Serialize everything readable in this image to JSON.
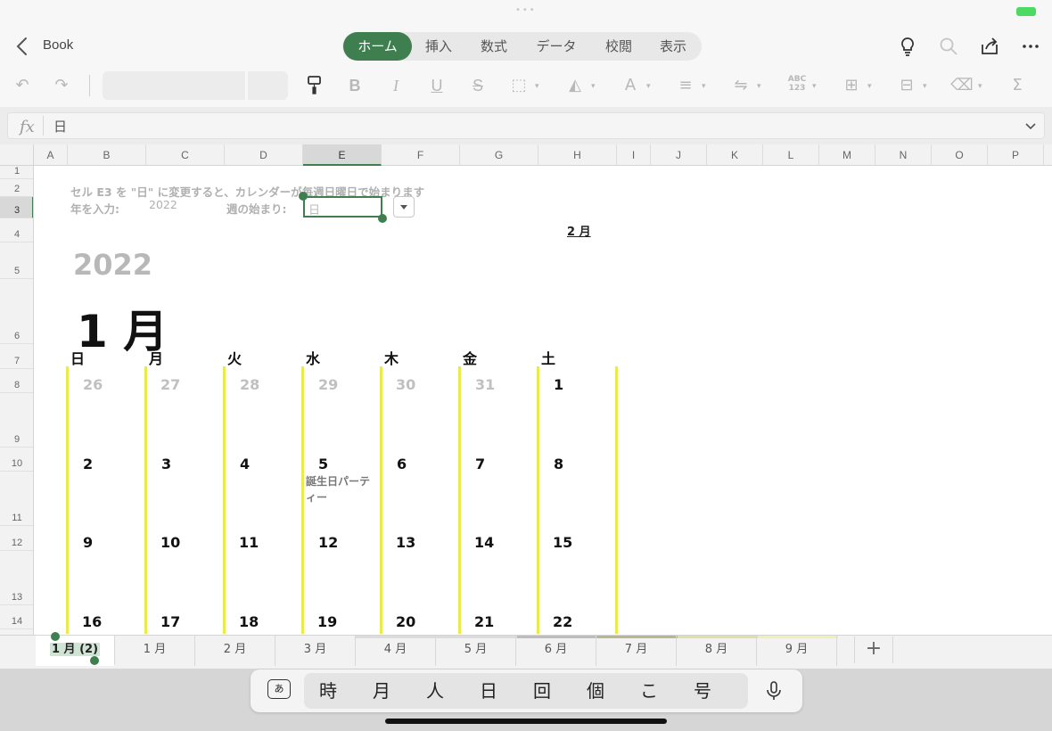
{
  "app": {
    "book_title": "Book"
  },
  "ribbon": {
    "tabs": [
      {
        "label": "ホーム",
        "active": true
      },
      {
        "label": "挿入"
      },
      {
        "label": "数式"
      },
      {
        "label": "データ"
      },
      {
        "label": "校閲"
      },
      {
        "label": "表示"
      }
    ],
    "accent_color": "#3f7f4f",
    "icons": [
      "lightbulb-icon",
      "search-icon",
      "share-icon",
      "more-icon"
    ],
    "toolbar": {
      "number_format_label": "ABC\n123",
      "sum_label": "Σ"
    }
  },
  "formula_bar": {
    "fx_label": "fx",
    "value": "日"
  },
  "grid": {
    "columns": [
      "A",
      "B",
      "C",
      "D",
      "E",
      "F",
      "G",
      "H",
      "I",
      "J",
      "K",
      "L",
      "M",
      "N",
      "O",
      "P"
    ],
    "selected_column": "E",
    "rows": [
      "1",
      "2",
      "3",
      "4",
      "5",
      "6",
      "7",
      "8",
      "9",
      "10",
      "11",
      "12",
      "13",
      "14"
    ],
    "selected_row": "3"
  },
  "sheet": {
    "instruction": "セル E3 を \"日\" に変更すると、カレンダーが毎週日曜日で始まります",
    "year_prompt": "年を入力:",
    "year_value": "2022",
    "week_start_label": "週の始まり:",
    "week_start_value": "日",
    "next_month_label": "2 月",
    "year_heading": "2022",
    "month_heading": "1 月",
    "weekdays": [
      "日",
      "月",
      "火",
      "水",
      "木",
      "金",
      "土"
    ],
    "weeks": [
      [
        "26",
        "27",
        "28",
        "29",
        "30",
        "31",
        "1"
      ],
      [
        "2",
        "3",
        "4",
        "5",
        "6",
        "7",
        "8"
      ],
      [
        "9",
        "10",
        "11",
        "12",
        "13",
        "14",
        "15"
      ],
      [
        "16",
        "17",
        "18",
        "19",
        "20",
        "21",
        "22"
      ]
    ],
    "event_text": "誕生日パーティー",
    "divider_color": "#e8ea50"
  },
  "sheet_tabs": {
    "items": [
      {
        "label": "1 月 (2)",
        "active": true
      },
      {
        "label": "1 月"
      },
      {
        "label": "2 月"
      },
      {
        "label": "3 月"
      },
      {
        "label": "4 月"
      },
      {
        "label": "5 月"
      },
      {
        "label": "6 月"
      },
      {
        "label": "7 月"
      },
      {
        "label": "8 月"
      },
      {
        "label": "9 月"
      }
    ],
    "add_label": "+"
  },
  "keyboard": {
    "ime_label": "あ",
    "candidates": [
      "時",
      "月",
      "人",
      "日",
      "回",
      "個",
      "こ",
      "号"
    ]
  }
}
